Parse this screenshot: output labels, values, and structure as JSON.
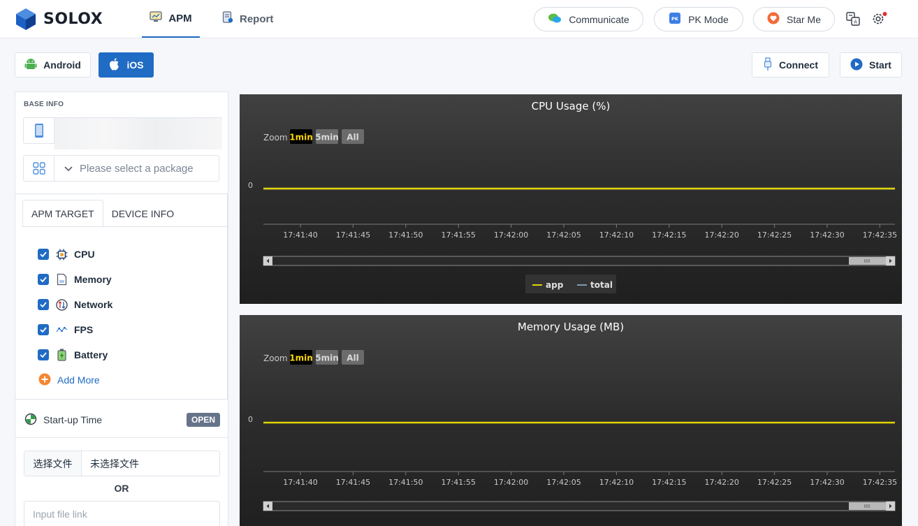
{
  "app": {
    "name": "SOLOX",
    "nav": [
      {
        "label": "APM",
        "icon": "monitor-chart-icon",
        "active": true
      },
      {
        "label": "Report",
        "icon": "report-icon",
        "active": false
      }
    ],
    "actions": [
      {
        "label": "Communicate",
        "icon": "chat-icon"
      },
      {
        "label": "PK Mode",
        "icon": "pk-icon"
      },
      {
        "label": "Star Me",
        "icon": "heart-icon"
      }
    ],
    "accent": "#206bc4"
  },
  "toolbar": {
    "android_label": "Android",
    "ios_label": "iOS",
    "connect_label": "Connect",
    "start_label": "Start"
  },
  "panel": {
    "base_info_title": "BASE INFO",
    "package_placeholder": "Please select a package",
    "tabs": [
      {
        "label": "APM TARGET",
        "active": true
      },
      {
        "label": "DEVICE INFO",
        "active": false
      }
    ],
    "targets": [
      {
        "label": "CPU",
        "checked": true,
        "icon": "cpu-icon"
      },
      {
        "label": "Memory",
        "checked": true,
        "icon": "memory-icon"
      },
      {
        "label": "Network",
        "checked": true,
        "icon": "network-icon"
      },
      {
        "label": "FPS",
        "checked": true,
        "icon": "fps-icon"
      },
      {
        "label": "Battery",
        "checked": true,
        "icon": "battery-icon"
      }
    ],
    "add_more_label": "Add More",
    "startup_label": "Start-up Time",
    "startup_badge": "OPEN",
    "file_button_label": "选择文件",
    "file_status": "未选择文件",
    "or_label": "OR",
    "file_link_placeholder": "Input file link"
  },
  "chart_data": [
    {
      "type": "line",
      "title": "CPU Usage (%)",
      "zoom_label": "Zoom",
      "zoom_options": [
        "1min",
        "5min",
        "All"
      ],
      "zoom_selected": "1min",
      "x": [
        "17:41:40",
        "17:41:45",
        "17:41:50",
        "17:41:55",
        "17:42:00",
        "17:42:05",
        "17:42:10",
        "17:42:15",
        "17:42:20",
        "17:42:25",
        "17:42:30",
        "17:42:35"
      ],
      "y_tick_labels": [
        "0"
      ],
      "series": [
        {
          "name": "app",
          "color": "#e2d400",
          "values": [
            0,
            0,
            0,
            0,
            0,
            0,
            0,
            0,
            0,
            0,
            0,
            0
          ]
        },
        {
          "name": "total",
          "color": "#7f9bb5",
          "values": [
            0,
            0,
            0,
            0,
            0,
            0,
            0,
            0,
            0,
            0,
            0,
            0
          ]
        }
      ],
      "legend": "bottom-center",
      "grid": false
    },
    {
      "type": "line",
      "title": "Memory Usage (MB)",
      "zoom_label": "Zoom",
      "zoom_options": [
        "1min",
        "5min",
        "All"
      ],
      "zoom_selected": "1min",
      "x": [
        "17:41:40",
        "17:41:45",
        "17:41:50",
        "17:41:55",
        "17:42:00",
        "17:42:05",
        "17:42:10",
        "17:42:15",
        "17:42:20",
        "17:42:25",
        "17:42:30",
        "17:42:35"
      ],
      "y_tick_labels": [
        "0"
      ],
      "series": [
        {
          "name": "app",
          "color": "#e2d400",
          "values": [
            0,
            0,
            0,
            0,
            0,
            0,
            0,
            0,
            0,
            0,
            0,
            0
          ]
        }
      ],
      "grid": false
    }
  ]
}
